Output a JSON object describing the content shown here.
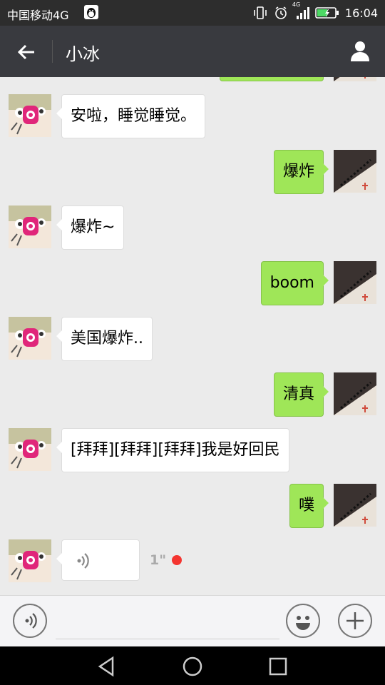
{
  "status_bar": {
    "carrier": "中国移动4G",
    "network": "4G",
    "time": "16:04"
  },
  "header": {
    "title": "小冰"
  },
  "messages": [
    {
      "side": "right",
      "text": ""
    },
    {
      "side": "left",
      "text": "安啦，睡觉睡觉。"
    },
    {
      "side": "right",
      "text": "爆炸"
    },
    {
      "side": "left",
      "text": "爆炸~"
    },
    {
      "side": "right",
      "text": "boom"
    },
    {
      "side": "left",
      "text": "美国爆炸.."
    },
    {
      "side": "right",
      "text": "清真"
    },
    {
      "side": "left",
      "text": "[拜拜][拜拜][拜拜]我是好回民"
    },
    {
      "side": "right",
      "text": "噗"
    },
    {
      "side": "left",
      "type": "voice",
      "duration": "1\""
    }
  ],
  "colors": {
    "status_bar": "#2d2d2d",
    "title_bar": "#393a3f",
    "chat_bg": "#ebebeb",
    "sent_bubble": "#9fe658",
    "received_bubble": "#ffffff",
    "unread_dot": "#f43530"
  },
  "icons": {
    "back": "arrow-left-icon",
    "profile": "user-icon",
    "voice_input": "voice-icon",
    "emoji": "emoji-icon",
    "more": "plus-icon"
  }
}
